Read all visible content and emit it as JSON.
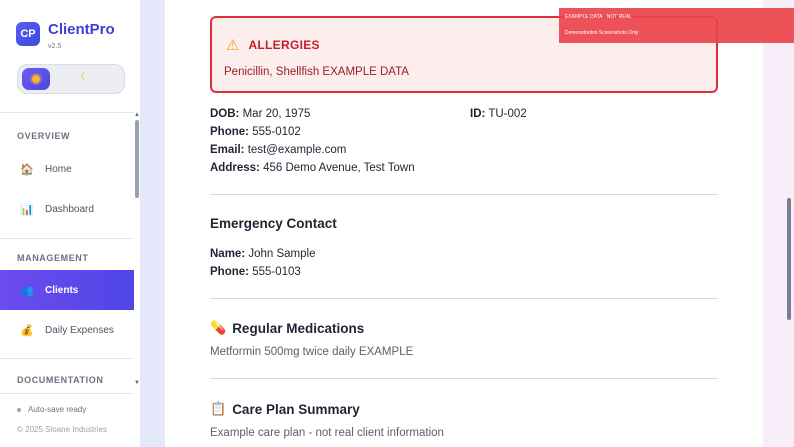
{
  "app": {
    "logo_text": "CP",
    "title": "ClientPro",
    "version": "v2.5"
  },
  "theme": {
    "light_icon": "sun-icon",
    "dark_icon": "moon-icon",
    "dark_glyph": "☾"
  },
  "sidebar": {
    "sections": [
      {
        "label": "OVERVIEW"
      },
      {
        "label": "MANAGEMENT"
      },
      {
        "label": "DOCUMENTATION"
      }
    ],
    "items": [
      {
        "label": "Home",
        "icon": "house-icon",
        "glyph": "🏠"
      },
      {
        "label": "Dashboard",
        "icon": "bar-chart-icon",
        "glyph": "📊"
      },
      {
        "label": "Clients",
        "icon": "people-icon",
        "glyph": "👥",
        "active": true
      },
      {
        "label": "Daily Expenses",
        "icon": "money-bag-icon",
        "glyph": "💰"
      }
    ],
    "status": "Auto-save ready",
    "copyright": "© 2025 Sloane Industries"
  },
  "watermark": {
    "line1": "EXAMPLE DATA · NOT REAL",
    "line2": "Demonstration Screenshots Only"
  },
  "allergies": {
    "heading": "ALLERGIES",
    "icon": "warning-icon",
    "glyph": "⚠",
    "text": "Penicillin, Shellfish EXAMPLE DATA"
  },
  "client": {
    "dob_label": "DOB:",
    "dob": "Mar 20, 1975",
    "id_label": "ID:",
    "id": "TU-002",
    "phone_label": "Phone:",
    "phone": "555-0102",
    "email_label": "Email:",
    "email": "test@example.com",
    "address_label": "Address:",
    "address": "456 Demo Avenue, Test Town"
  },
  "emergency": {
    "title": "Emergency Contact",
    "name_label": "Name:",
    "name": "John Sample",
    "phone_label": "Phone:",
    "phone": "555-0103"
  },
  "medications": {
    "title": "Regular Medications",
    "icon": "pill-icon",
    "glyph": "💊",
    "text": "Metformin 500mg twice daily EXAMPLE"
  },
  "care_plan": {
    "title": "Care Plan Summary",
    "icon": "clipboard-icon",
    "glyph": "📋",
    "text": "Example care plan - not real client information"
  },
  "colors": {
    "brand": "#3a3fd6",
    "active_nav": "#5b48ee",
    "alert_border": "#dc2f38",
    "alert_bg": "#fdeeee",
    "watermark": "#ea444a"
  }
}
